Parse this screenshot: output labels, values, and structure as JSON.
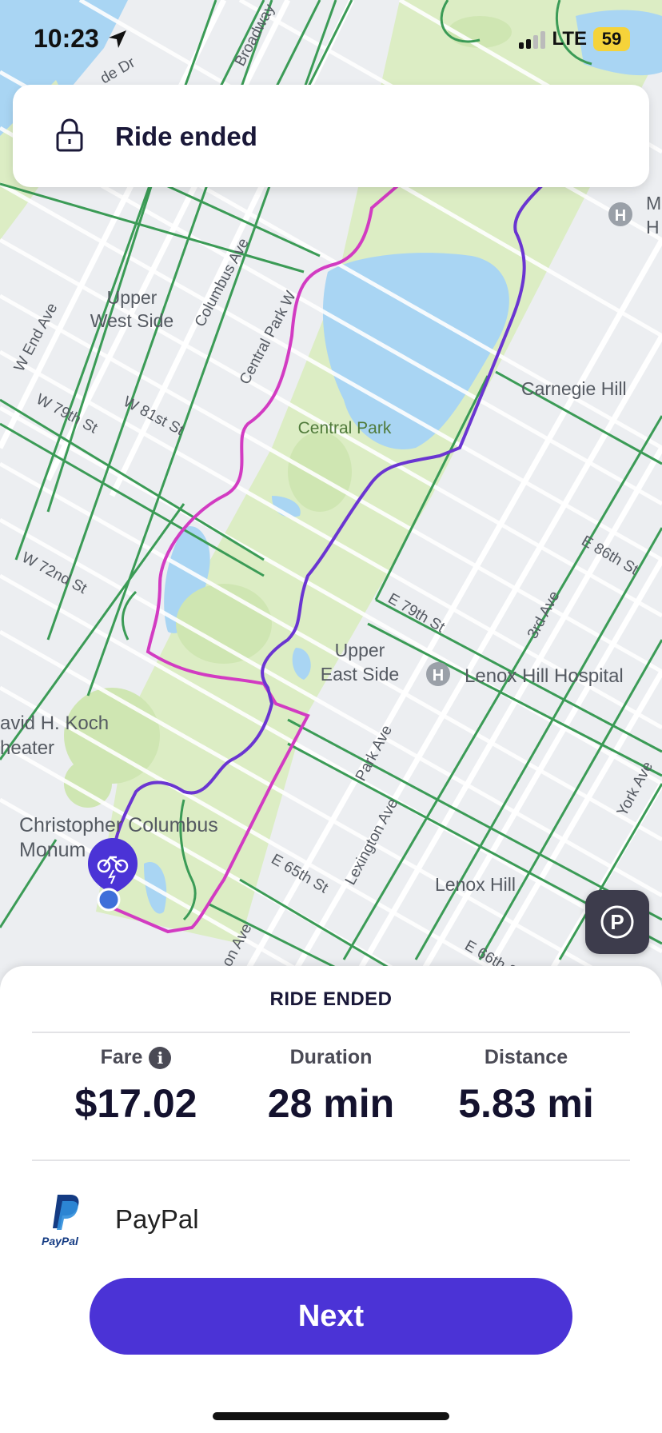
{
  "status_bar": {
    "time": "10:23",
    "network": "LTE",
    "battery": "59"
  },
  "toast": {
    "text": "Ride ended"
  },
  "map": {
    "labels": {
      "broadway": "Broadway",
      "upper_west_side_1": "Upper",
      "upper_west_side_2": "West Side",
      "columbus_ave": "Columbus Ave",
      "central_park_w": "Central Park W",
      "w_end_ave": "W End Ave",
      "w_79th": "W 79th St",
      "w_81st": "W 81st St",
      "w_72nd": "W 72nd St",
      "central_park": "Central Park",
      "carnegie_hill": "Carnegie Hill",
      "e_86th": "E 86th St",
      "e_79th": "E 79th St",
      "third_ave": "3rd Ave",
      "upper_east_side_1": "Upper",
      "upper_east_side_2": "East Side",
      "lenox_hill_hospital": "Lenox Hill Hospital",
      "koch_1": "avid H. Koch",
      "koch_2": "heater",
      "park_ave": "Park Ave",
      "york_ave": "York Ave",
      "columbus_monument_1": "Christopher Columbus",
      "columbus_monument_2": "Monum",
      "lexington_ave": "Lexington Ave",
      "e_65th": "E 65th St",
      "lenox_hill": "Lenox Hill",
      "e_66th": "E 66th S",
      "on_ave": "on Ave",
      "de_dr": "de Dr",
      "h_m": "M",
      "h_h": "H"
    },
    "colors": {
      "route_purple": "#6a35d1",
      "route_magenta": "#d23bc2",
      "bike_lane": "#3b9b56",
      "park": "#dceec4",
      "water": "#aad6f2"
    }
  },
  "ride": {
    "title": "RIDE ENDED",
    "fare_label": "Fare",
    "fare_value": "$17.02",
    "duration_label": "Duration",
    "duration_value": "28 min",
    "distance_label": "Distance",
    "distance_value": "5.83 mi",
    "payment_method": "PayPal",
    "payment_logo_text": "PayPal",
    "next_label": "Next"
  }
}
